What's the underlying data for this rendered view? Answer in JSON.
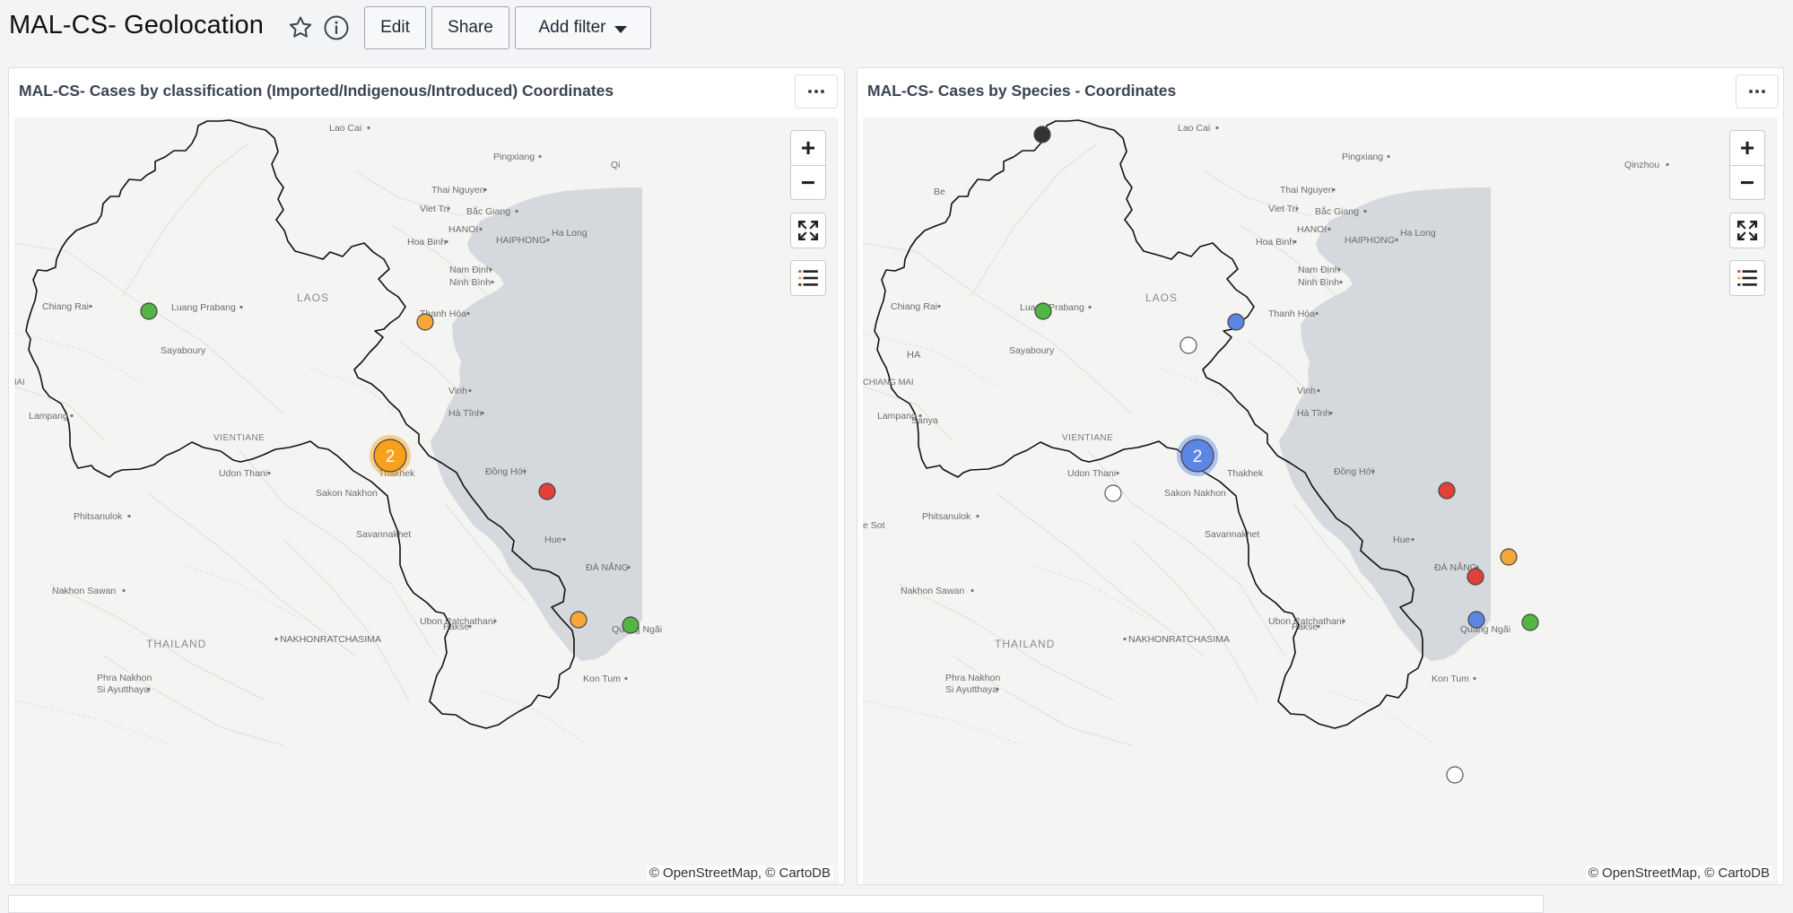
{
  "header": {
    "title": "MAL-CS- Geolocation",
    "edit_label": "Edit",
    "share_label": "Share",
    "filter_label": "Add filter"
  },
  "panels": [
    {
      "title": "MAL-CS- Cases by classification (Imported/Indigenous/Introduced) Coordinates",
      "cluster_count": "2",
      "cluster_color": "#f7a11a",
      "attribution": "© OpenStreetMap, © CartoDB"
    },
    {
      "title": "MAL-CS- Cases by Species - Coordinates",
      "cluster_count": "2",
      "cluster_color": "#5b86e5",
      "attribution": "© OpenStreetMap, © CartoDB"
    }
  ],
  "map": {
    "labels": {
      "lao_cai": "Lao Cai",
      "pingxiang": "Pingxiang",
      "qinzhou": "Qinzhou",
      "qinzhou_short": "Qi",
      "beihai_short": "Be",
      "thai_nguyen": "Thai Nguyen",
      "viet_tri": "Viet Tri",
      "bac_giang": "Bắc Giang",
      "hanoi": "HANOI",
      "haiphong": "HAIPHONG",
      "ha_long": "Ha Long",
      "hoa_binh": "Hoa Binh",
      "nam_dinh": "Nam Định",
      "ninh_binh": "Ninh Bình",
      "laos": "LAOS",
      "luang_prabang": "Luang Prabang",
      "chiang_rai": "Chiang Rai",
      "chiang_mai_left": "IAI",
      "chiang_mai_right": "CHIANG MAI",
      "sayabouri": "Sayaboury",
      "thanh_hoa": "Thanh Hóa",
      "vinh": "Vinh",
      "ha_tinh": "Hà Tĩnh",
      "lampang": "Lampang",
      "vientiane": "VIENTIANE",
      "udon_thani": "Udon Thani",
      "thakhek": "Thakhek",
      "dong_hoi": "Đồng Hới",
      "sakon_nakhon": "Sakon Nakhon",
      "phitsanulok": "Phitsanulok",
      "mae_sot": "e Sot",
      "savannakhet": "Savannakhet",
      "hue": "Hue",
      "da_nang": "ĐÀ NẴNG",
      "nakhon_sawan": "Nakhon Sawan",
      "ubon": "Ubon Ratchathani",
      "pakse": "Pakse",
      "quang_ngai": "Quảng Ngãi",
      "thailand": "THAILAND",
      "nakhonratchasima": "NAKHONRATCHASIMA",
      "phra_nakhon": "Phra Nakhon",
      "si_ayutthaya": "Si Ayutthaya",
      "kon_tum": "Kon Tum",
      "sanya": "Sanya",
      "hainan_short": "HA"
    }
  },
  "colors": {
    "green": "#53b543",
    "orange": "#f7a73a",
    "red": "#e4403a",
    "blue": "#5b86e5",
    "white": "#ffffff",
    "dark": "#333333",
    "sea": "#d5d8dc",
    "border": "#111111"
  }
}
